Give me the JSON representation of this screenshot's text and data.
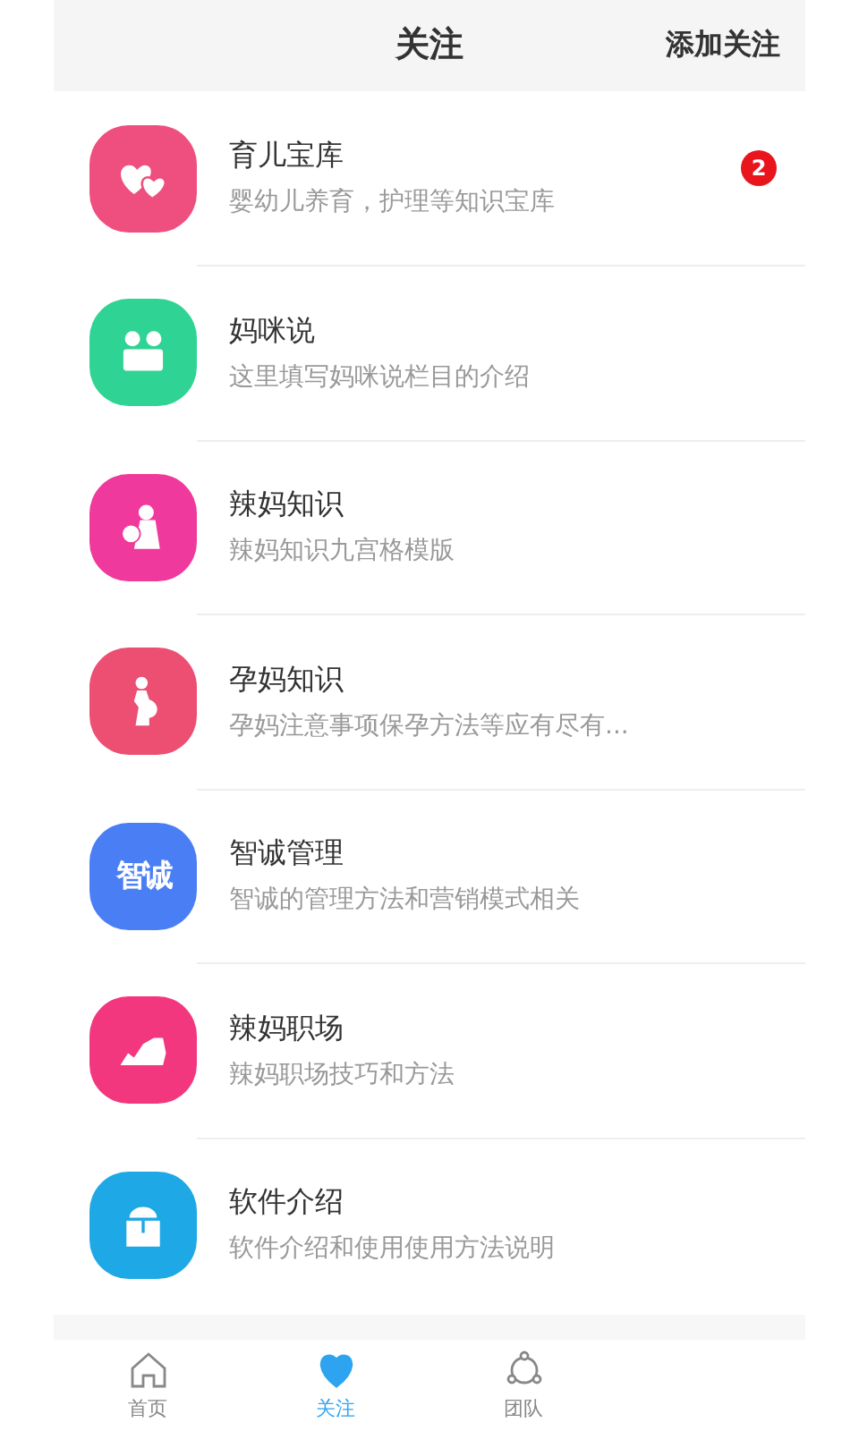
{
  "header": {
    "title": "关注",
    "action": "添加关注"
  },
  "items": [
    {
      "kind": "hearts",
      "color": "#ee4f7e",
      "title": "育儿宝库",
      "description": "婴幼儿养育，护理等知识宝库",
      "badge": "2"
    },
    {
      "kind": "chat",
      "color": "#2fd393",
      "title": "妈咪说",
      "description": "这里填写妈咪说栏目的介绍"
    },
    {
      "kind": "mother",
      "color": "#f0399c",
      "title": "辣妈知识",
      "description": "辣妈知识九宫格模版"
    },
    {
      "kind": "pregnant",
      "color": "#ec4f72",
      "title": "孕妈知识",
      "description": "孕妈注意事项保孕方法等应有尽有..."
    },
    {
      "kind": "text",
      "color": "#4a7ef5",
      "icon_text": "智诚",
      "title": "智诚管理",
      "description": "智诚的管理方法和营销模式相关"
    },
    {
      "kind": "shoe",
      "color": "#f2377e",
      "title": "辣妈职场",
      "description": "辣妈职场技巧和方法"
    },
    {
      "kind": "box",
      "color": "#1ea8e6",
      "title": "软件介绍",
      "description": "软件介绍和使用使用方法说明"
    }
  ],
  "tabs": [
    {
      "label": "首页",
      "selected": false
    },
    {
      "label": "关注",
      "selected": true
    },
    {
      "label": "团队",
      "selected": false
    }
  ]
}
